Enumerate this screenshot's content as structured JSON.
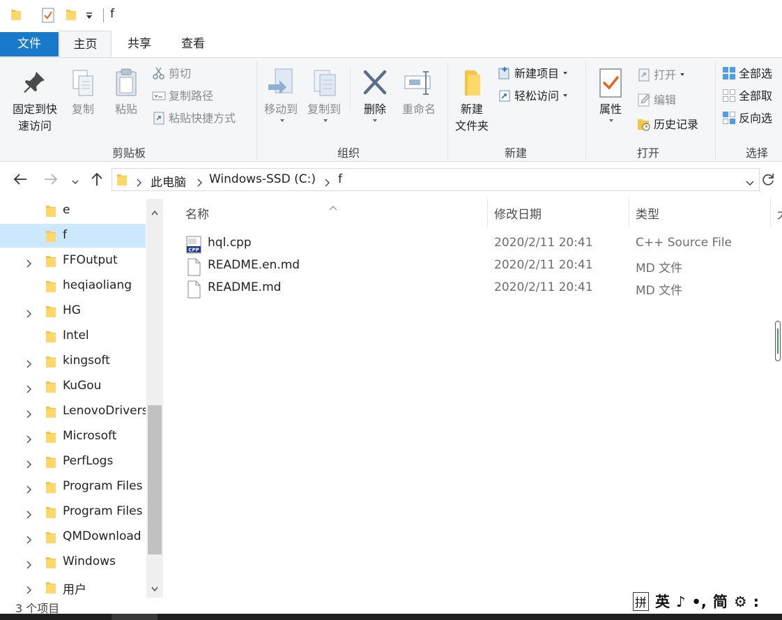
{
  "window": {
    "title": "f"
  },
  "tabs": {
    "file": "文件",
    "home": "主页",
    "share": "共享",
    "view": "查看"
  },
  "ribbon": {
    "clipboard": {
      "label": "剪贴板",
      "pin_line1": "固定到快",
      "pin_line2": "速访问",
      "copy": "复制",
      "paste": "粘贴",
      "cut": "剪切",
      "copy_path": "复制路径",
      "paste_shortcut": "粘贴快捷方式"
    },
    "organize": {
      "label": "组织",
      "move_to": "移动到",
      "copy_to": "复制到",
      "delete": "删除",
      "rename": "重命名"
    },
    "new": {
      "label": "新建",
      "new_folder_line1": "新建",
      "new_folder_line2": "文件夹",
      "new_item": "新建项目",
      "easy_access": "轻松访问"
    },
    "open": {
      "label": "打开",
      "properties": "属性",
      "open": "打开",
      "edit": "编辑",
      "history": "历史记录"
    },
    "select": {
      "label": "选择",
      "select_all": "全部选",
      "select_none": "全部取",
      "invert": "反向选"
    }
  },
  "address": {
    "crumbs": [
      "此电脑",
      "Windows-SSD (C:)",
      "f"
    ]
  },
  "nav_tree": [
    {
      "label": "e",
      "expandable": false,
      "selected": false
    },
    {
      "label": "f",
      "expandable": false,
      "selected": true
    },
    {
      "label": "FFOutput",
      "expandable": true,
      "selected": false
    },
    {
      "label": "heqiaoliang",
      "expandable": false,
      "selected": false
    },
    {
      "label": "HG",
      "expandable": true,
      "selected": false
    },
    {
      "label": "Intel",
      "expandable": false,
      "selected": false
    },
    {
      "label": "kingsoft",
      "expandable": true,
      "selected": false
    },
    {
      "label": "KuGou",
      "expandable": true,
      "selected": false
    },
    {
      "label": "LenovoDrivers",
      "expandable": true,
      "selected": false
    },
    {
      "label": "Microsoft",
      "expandable": true,
      "selected": false
    },
    {
      "label": "PerfLogs",
      "expandable": true,
      "selected": false
    },
    {
      "label": "Program Files",
      "expandable": true,
      "selected": false
    },
    {
      "label": "Program Files",
      "expandable": true,
      "selected": false
    },
    {
      "label": "QMDownload",
      "expandable": true,
      "selected": false
    },
    {
      "label": "Windows",
      "expandable": true,
      "selected": false
    },
    {
      "label": "用户",
      "expandable": true,
      "selected": false
    }
  ],
  "columns": {
    "name": "名称",
    "modified": "修改日期",
    "type": "类型",
    "size": "大"
  },
  "files": [
    {
      "name": "hql.cpp",
      "modified": "2020/2/11 20:41",
      "type": "C++ Source File",
      "icon": "cpp-file-icon"
    },
    {
      "name": "README.en.md",
      "modified": "2020/2/11 20:41",
      "type": "MD 文件",
      "icon": "blank-file-icon"
    },
    {
      "name": "README.md",
      "modified": "2020/2/11 20:41",
      "type": "MD 文件",
      "icon": "blank-file-icon"
    }
  ],
  "status": {
    "item_count": "3 个项目"
  },
  "ime": {
    "pinyin": "拼",
    "lang": "英",
    "punct": "♪",
    "comma": "•,",
    "simplified": "简",
    "settings": "⚙",
    "more": ":"
  },
  "colors": {
    "accent": "#1979ca",
    "selection": "#cce8ff",
    "folder": "#f6c343"
  }
}
